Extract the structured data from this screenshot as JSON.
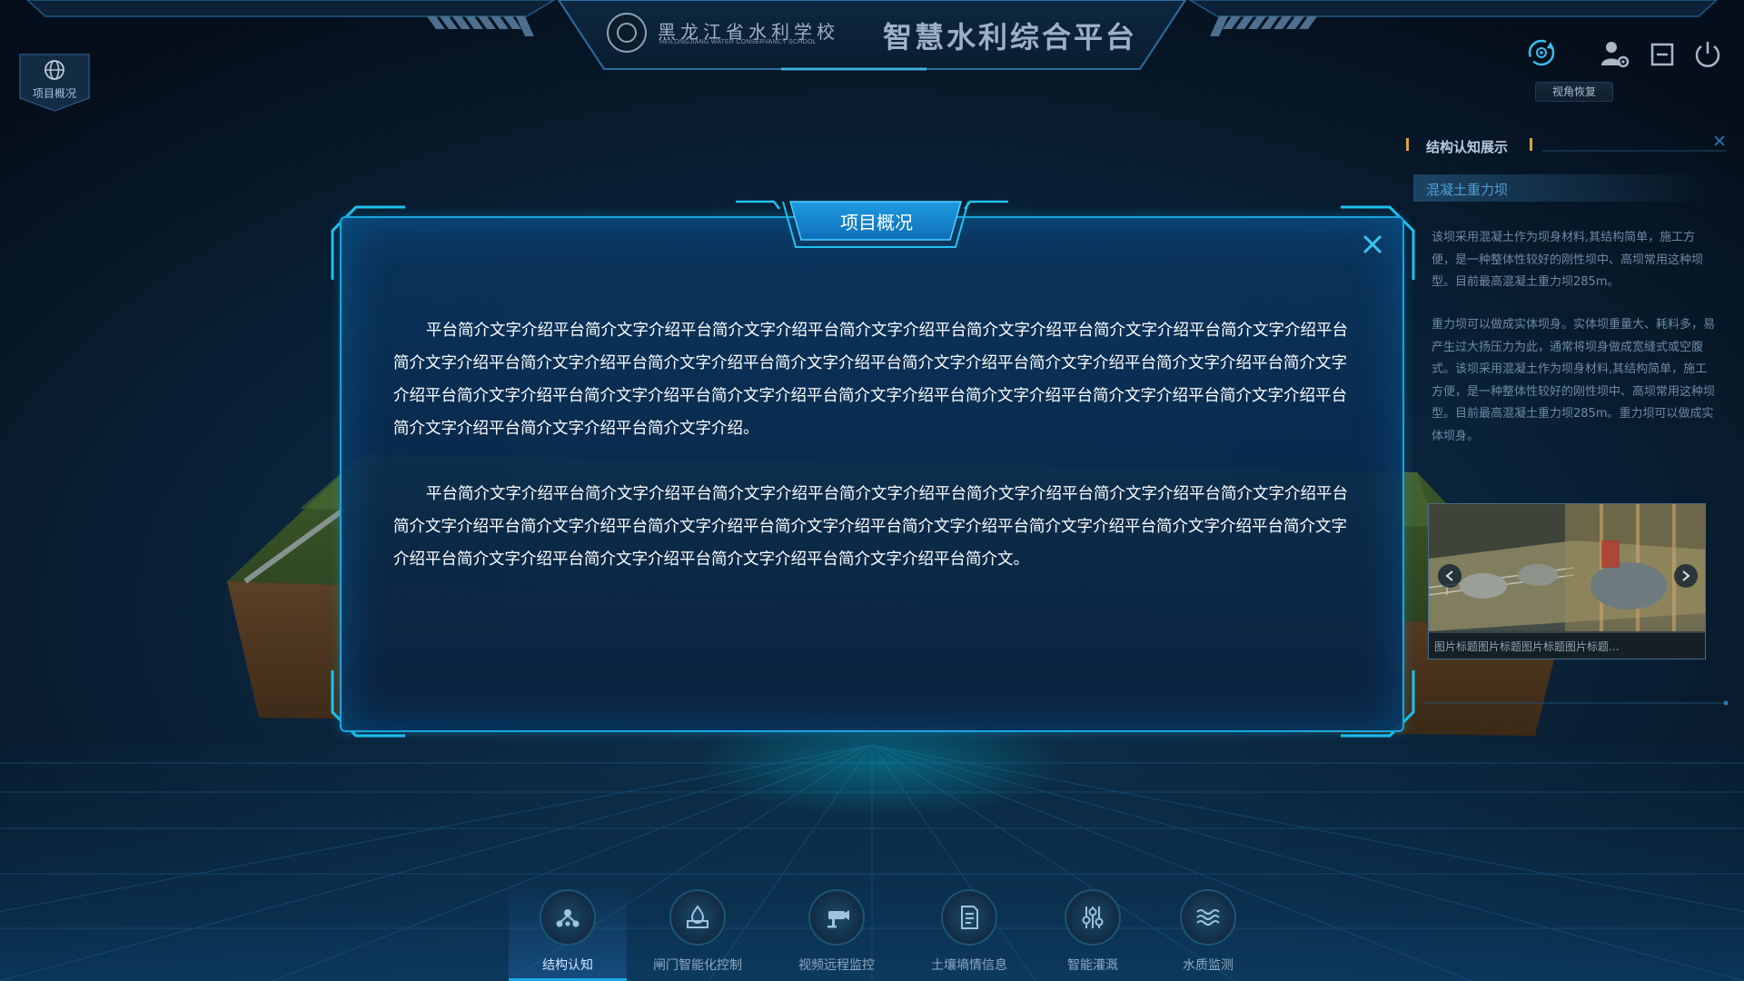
{
  "header": {
    "school_name_cn": "黑龙江省水利学校",
    "school_name_en": "HEILONGJIANG WATER CONSERVANCY SCHOOL",
    "app_title": "智慧水利综合平台",
    "reset_view_label": "视角恢复",
    "icons": [
      "reset-view-icon",
      "user-settings-icon",
      "minimize-icon",
      "power-icon"
    ]
  },
  "left_tab": {
    "label": "项目概况",
    "icon": "globe-icon"
  },
  "right_panel": {
    "title": "结构认知展示",
    "subtitle": "混凝土重力坝",
    "paragraph1": "该坝采用混凝土作为坝身材料,其结构简单，施工方便，是一种整体性较好的刚性坝中、高坝常用这种坝型。目前最高混凝土重力坝285m。",
    "paragraph2": "重力坝可以做成实体坝身。实体坝重量大、耗料多，易产生过大扬压力为此，通常将坝身做成宽缝式或空腹式。该坝采用混凝土作为坝身材料,其结构简单，施工方便，是一种整体性较好的刚性坝中、高坝常用这种坝型。目前最高混凝土重力坝285m。重力坝可以做成实体坝身。",
    "gallery_caption": "图片标题图片标题图片标题图片标题..."
  },
  "modal": {
    "title": "项目概况",
    "paragraph1": "平台简介文字介绍平台简介文字介绍平台简介文字介绍平台简介文字介绍平台简介文字介绍平台简介文字介绍平台简介文字介绍平台简介文字介绍平台简介文字介绍平台简介文字介绍平台简介文字介绍平台简介文字介绍平台简介文字介绍平台简介文字介绍平台简介文字介绍平台简介文字介绍平台简介文字介绍平台简介文字介绍平台简介文字介绍平台简介文字介绍平台简介文字介绍平台简介文字介绍平台简介文字介绍平台简介文字介绍平台简介文字介绍。",
    "paragraph2": "平台简介文字介绍平台简介文字介绍平台简介文字介绍平台简介文字介绍平台简介文字介绍平台简介文字介绍平台简介文字介绍平台简介文字介绍平台简介文字介绍平台简介文字介绍平台简介文字介绍平台简介文字介绍平台简介文字介绍平台简介文字介绍平台简介文字介绍平台简介文字介绍平台简介文字介绍平台简介文字介绍平台简介文字介绍平台简介文。"
  },
  "bottom_nav": [
    {
      "label": "结构认知",
      "icon": "structure-icon",
      "active": true
    },
    {
      "label": "闸门智能化控制",
      "icon": "gate-control-icon",
      "active": false
    },
    {
      "label": "视频远程监控",
      "icon": "camera-icon",
      "active": false
    },
    {
      "label": "土壤墒情信息",
      "icon": "document-icon",
      "active": false
    },
    {
      "label": "智能灌溉",
      "icon": "sliders-icon",
      "active": false
    },
    {
      "label": "水质监测",
      "icon": "water-waves-icon",
      "active": false
    }
  ],
  "colors": {
    "background": "#06121f",
    "accent": "#1aa6dd",
    "modal_bg": "#0b3660",
    "gold_marker": "#d8a441",
    "subtitle": "#4d9fd4"
  }
}
